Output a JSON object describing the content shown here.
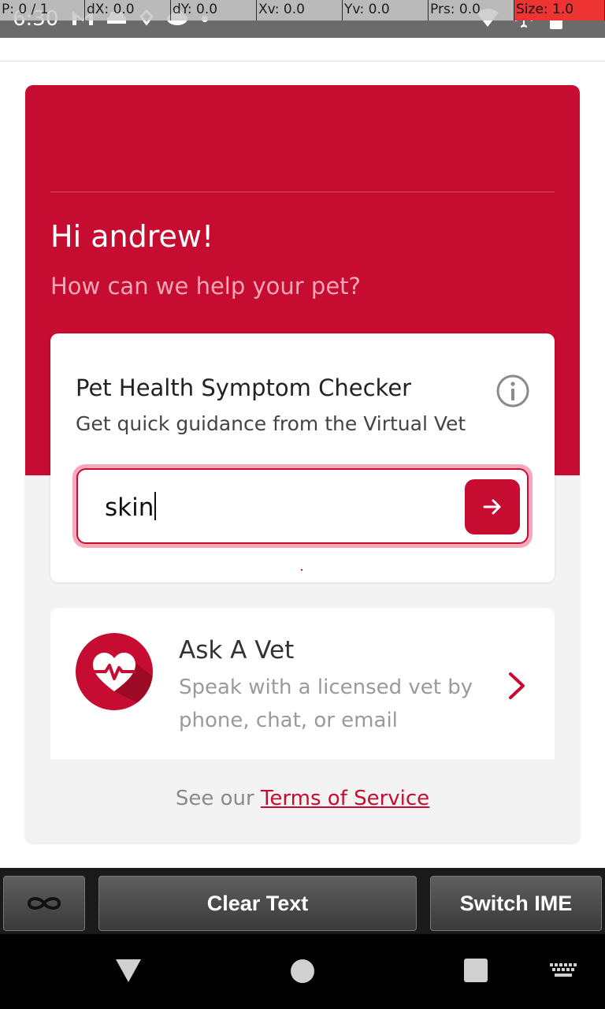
{
  "status_bar": {
    "time": "6:30",
    "overlay": [
      "P: 0 / 1",
      "dX: 0.0",
      "dY: 0.0",
      "Xv: 0.0",
      "Yv: 0.0",
      "Prs: 0.0",
      "Size: 1.0"
    ]
  },
  "hero": {
    "greeting": "Hi andrew!",
    "subtitle": "How can we help your pet?"
  },
  "checker": {
    "title": "Pet Health Symptom Checker",
    "subtitle": "Get quick guidance from the Virtual Vet",
    "search_value": "skin"
  },
  "ask_vet": {
    "title": "Ask A Vet",
    "description": "Speak with a licensed vet by phone, chat, or email"
  },
  "footer": {
    "tos_prefix": "See our",
    "tos_link": "Terms of Service"
  },
  "ime_bar": {
    "clear_label": "Clear Text",
    "switch_label": "Switch IME"
  },
  "colors": {
    "brand": "#c60c30",
    "brand_light": "#f7a9ba"
  },
  "icons": [
    "info-icon",
    "arrow-right-icon",
    "heart-pulse-icon",
    "chevron-right-icon",
    "infinity-icon",
    "back-icon",
    "home-icon",
    "recents-icon",
    "keyboard-icon"
  ]
}
